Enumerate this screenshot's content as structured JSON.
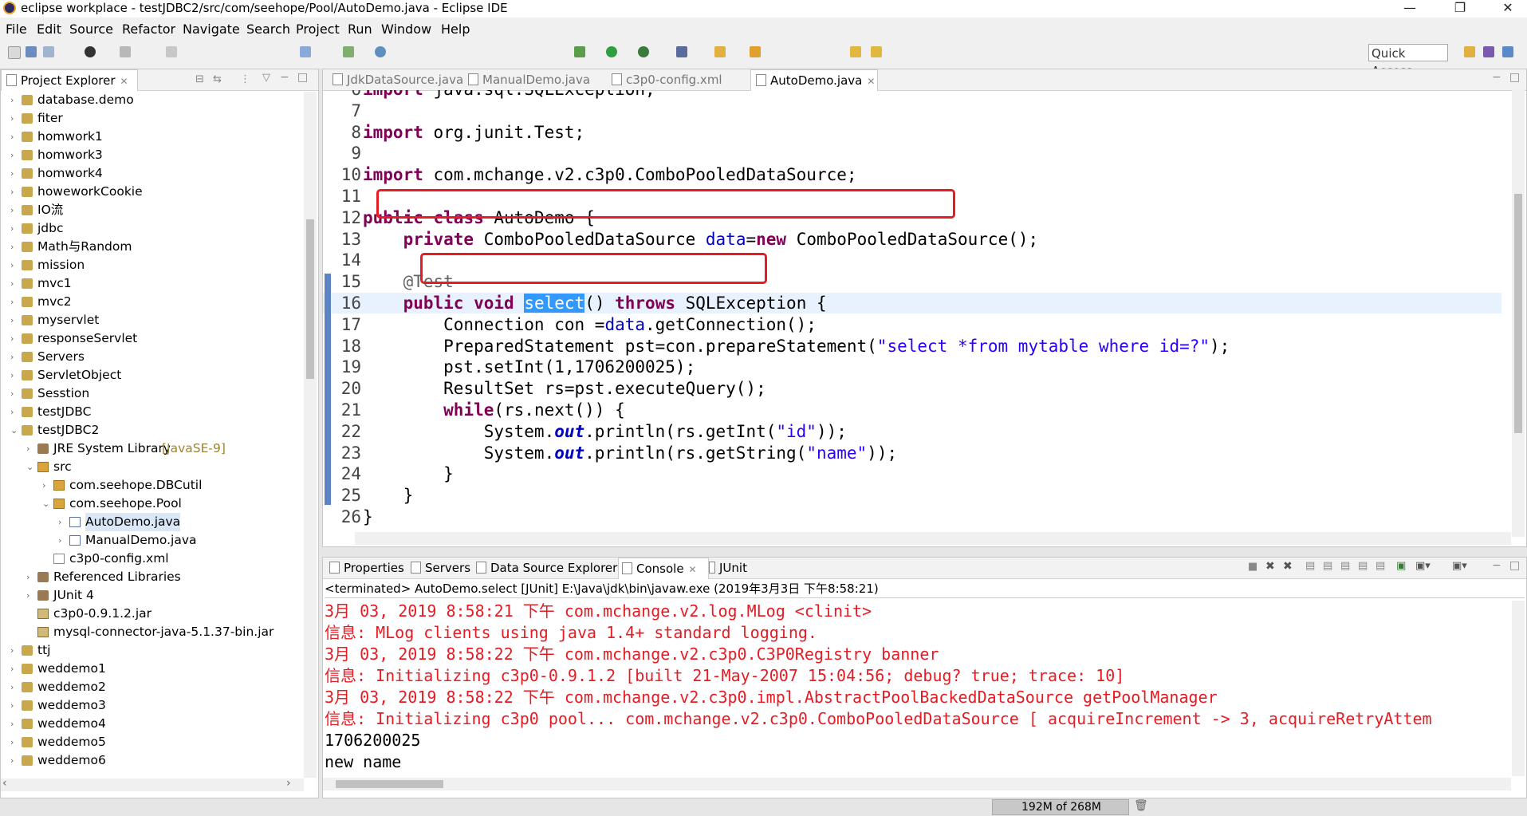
{
  "window": {
    "title": "eclipse workplace - testJDBC2/src/com/seehope/Pool/AutoDemo.java - Eclipse IDE",
    "minimize": "—",
    "maximize": "❐",
    "close": "✕"
  },
  "menu": [
    "File",
    "Edit",
    "Source",
    "Refactor",
    "Navigate",
    "Search",
    "Project",
    "Run",
    "Window",
    "Help"
  ],
  "quick_access": "Quick Access",
  "explorer": {
    "title": "Project Explorer",
    "items": [
      {
        "label": "database.demo"
      },
      {
        "label": "fiter"
      },
      {
        "label": "homwork1"
      },
      {
        "label": "homwork3"
      },
      {
        "label": "homwork4"
      },
      {
        "label": "howeworkCookie"
      },
      {
        "label": "IO流"
      },
      {
        "label": "jdbc"
      },
      {
        "label": "Math与Random"
      },
      {
        "label": "mission"
      },
      {
        "label": "mvc1"
      },
      {
        "label": "mvc2"
      },
      {
        "label": "myservlet"
      },
      {
        "label": "responseServlet"
      },
      {
        "label": "Servers"
      },
      {
        "label": "ServletObject"
      },
      {
        "label": "Sesstion"
      },
      {
        "label": "testJDBC"
      },
      {
        "label": "testJDBC2"
      },
      {
        "label": "JRE System Library",
        "extra": "[JavaSE-9]"
      },
      {
        "label": "src"
      },
      {
        "label": "com.seehope.DBCutil"
      },
      {
        "label": "com.seehope.Pool"
      },
      {
        "label": "AutoDemo.java"
      },
      {
        "label": "ManualDemo.java"
      },
      {
        "label": "c3p0-config.xml"
      },
      {
        "label": "Referenced Libraries"
      },
      {
        "label": "JUnit 4"
      },
      {
        "label": "c3p0-0.9.1.2.jar"
      },
      {
        "label": "mysql-connector-java-5.1.37-bin.jar"
      },
      {
        "label": "ttj"
      },
      {
        "label": "weddemo1"
      },
      {
        "label": "weddemo2"
      },
      {
        "label": "weddemo3"
      },
      {
        "label": "weddemo4"
      },
      {
        "label": "weddemo5"
      },
      {
        "label": "weddemo6"
      }
    ]
  },
  "editor": {
    "tabs": [
      "JdkDataSource.java",
      "ManualDemo.java",
      "c3p0-config.xml",
      "AutoDemo.java"
    ],
    "active_tab": "AutoDemo.java",
    "lines": [
      {
        "n": "6",
        "segs": [
          {
            "c": "kw",
            "t": "import"
          },
          {
            "c": "",
            "t": " java.sql.SQLException;"
          }
        ]
      },
      {
        "n": "7",
        "segs": []
      },
      {
        "n": "8",
        "segs": [
          {
            "c": "kw",
            "t": "import"
          },
          {
            "c": "",
            "t": " org.junit.Test;"
          }
        ]
      },
      {
        "n": "9",
        "segs": []
      },
      {
        "n": "10",
        "segs": [
          {
            "c": "kw",
            "t": "import"
          },
          {
            "c": "",
            "t": " com.mchange.v2.c3p0.ComboPooledDataSource;"
          }
        ]
      },
      {
        "n": "11",
        "segs": []
      },
      {
        "n": "12",
        "segs": [
          {
            "c": "kw",
            "t": "public"
          },
          {
            "c": "",
            "t": " "
          },
          {
            "c": "kw",
            "t": "class"
          },
          {
            "c": "",
            "t": " AutoDemo {"
          }
        ]
      },
      {
        "n": "13",
        "segs": [
          {
            "c": "",
            "t": "    "
          },
          {
            "c": "kw",
            "t": "private"
          },
          {
            "c": "",
            "t": " ComboPooledDataSource "
          },
          {
            "c": "fld",
            "t": "data"
          },
          {
            "c": "",
            "t": "="
          },
          {
            "c": "kw",
            "t": "new"
          },
          {
            "c": "",
            "t": " ComboPooledDataSource();"
          }
        ]
      },
      {
        "n": "14",
        "segs": []
      },
      {
        "n": "15",
        "segs": [
          {
            "c": "",
            "t": "    "
          },
          {
            "c": "ann",
            "t": "@Test"
          }
        ]
      },
      {
        "n": "16",
        "segs": [
          {
            "c": "",
            "t": "    "
          },
          {
            "c": "kw",
            "t": "public"
          },
          {
            "c": "",
            "t": " "
          },
          {
            "c": "kw",
            "t": "void"
          },
          {
            "c": "",
            "t": " "
          },
          {
            "c": "hl",
            "t": "select"
          },
          {
            "c": "",
            "t": "() "
          },
          {
            "c": "kw",
            "t": "throws"
          },
          {
            "c": "",
            "t": " SQLException {"
          }
        ]
      },
      {
        "n": "17",
        "segs": [
          {
            "c": "",
            "t": "        Connection con ="
          },
          {
            "c": "fld",
            "t": "data"
          },
          {
            "c": "",
            "t": ".getConnection();"
          }
        ]
      },
      {
        "n": "18",
        "segs": [
          {
            "c": "",
            "t": "        PreparedStatement pst=con.prepareStatement("
          },
          {
            "c": "str",
            "t": "\"select *from mytable where id=?\""
          },
          {
            "c": "",
            "t": ");"
          }
        ]
      },
      {
        "n": "19",
        "segs": [
          {
            "c": "",
            "t": "        pst.setInt(1,1706200025);"
          }
        ]
      },
      {
        "n": "20",
        "segs": [
          {
            "c": "",
            "t": "        ResultSet rs=pst.executeQuery();"
          }
        ]
      },
      {
        "n": "21",
        "segs": [
          {
            "c": "",
            "t": "        "
          },
          {
            "c": "kw",
            "t": "while"
          },
          {
            "c": "",
            "t": "(rs.next()) {"
          }
        ]
      },
      {
        "n": "22",
        "segs": [
          {
            "c": "",
            "t": "            System."
          },
          {
            "c": "stat",
            "t": "out"
          },
          {
            "c": "",
            "t": ".println(rs.getInt("
          },
          {
            "c": "str",
            "t": "\"id\""
          },
          {
            "c": "",
            "t": "));"
          }
        ]
      },
      {
        "n": "23",
        "segs": [
          {
            "c": "",
            "t": "            System."
          },
          {
            "c": "stat",
            "t": "out"
          },
          {
            "c": "",
            "t": ".println(rs.getString("
          },
          {
            "c": "str",
            "t": "\"name\""
          },
          {
            "c": "",
            "t": "));"
          }
        ]
      },
      {
        "n": "24",
        "segs": [
          {
            "c": "",
            "t": "        }"
          }
        ]
      },
      {
        "n": "25",
        "segs": [
          {
            "c": "",
            "t": "    }"
          }
        ]
      },
      {
        "n": "26",
        "segs": [
          {
            "c": "",
            "t": "}"
          }
        ]
      }
    ]
  },
  "console": {
    "tabs": [
      "Properties",
      "Servers",
      "Data Source Explorer",
      "Console",
      "JUnit"
    ],
    "active_tab": "Console",
    "header": "<terminated> AutoDemo.select [JUnit] E:\\Java\\jdk\\bin\\javaw.exe (2019年3月3日 下午8:58:21)",
    "lines": [
      {
        "c": "red",
        "t": "3月 03, 2019 8:58:21 下午 com.mchange.v2.log.MLog <clinit>"
      },
      {
        "c": "red",
        "t": "信息: MLog clients using java 1.4+ standard logging."
      },
      {
        "c": "red",
        "t": "3月 03, 2019 8:58:22 下午 com.mchange.v2.c3p0.C3P0Registry banner"
      },
      {
        "c": "red",
        "t": "信息: Initializing c3p0-0.9.1.2 [built 21-May-2007 15:04:56; debug? true; trace: 10]"
      },
      {
        "c": "red",
        "t": "3月 03, 2019 8:58:22 下午 com.mchange.v2.c3p0.impl.AbstractPoolBackedDataSource getPoolManager"
      },
      {
        "c": "red",
        "t": "信息: Initializing c3p0 pool... com.mchange.v2.c3p0.ComboPooledDataSource [ acquireIncrement -> 3, acquireRetryAttem"
      },
      {
        "c": "",
        "t": "1706200025"
      },
      {
        "c": "",
        "t": "new name"
      }
    ]
  },
  "status": {
    "memory": "192M of 268M"
  },
  "colors": {
    "keyword": "#7f0055",
    "string": "#2a00ff",
    "field": "#0000c0",
    "console_error": "#e51c23",
    "annotation_box": "#e51c23"
  }
}
